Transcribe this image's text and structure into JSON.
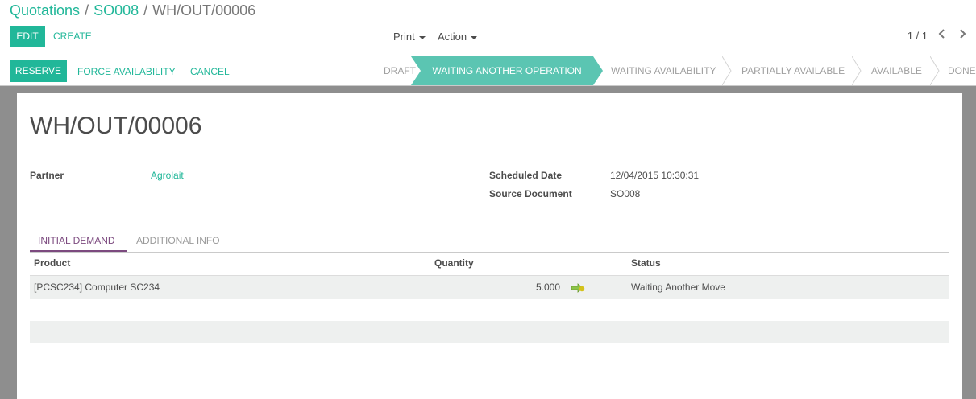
{
  "breadcrumb": {
    "items": [
      "Quotations",
      "SO008"
    ],
    "current": "WH/OUT/00006",
    "separator": "/"
  },
  "toolbar": {
    "edit_label": "EDIT",
    "create_label": "CREATE",
    "print_label": "Print",
    "action_label": "Action",
    "pager_text": "1 / 1"
  },
  "statusbar": {
    "buttons": {
      "reserve": "RESERVE",
      "force_availability": "FORCE AVAILABILITY",
      "cancel": "CANCEL"
    },
    "stages": {
      "draft": "DRAFT",
      "waiting_another_operation": "WAITING ANOTHER OPERATION",
      "waiting_availability": "WAITING AVAILABILITY",
      "partially_available": "PARTIALLY AVAILABLE",
      "available": "AVAILABLE",
      "done": "DONE"
    },
    "active_stage": "WAITING ANOTHER OPERATION"
  },
  "form": {
    "title": "WH/OUT/00006",
    "partner_label": "Partner",
    "partner_value": "Agrolait",
    "scheduled_date_label": "Scheduled Date",
    "scheduled_date_value": "12/04/2015 10:30:31",
    "source_document_label": "Source Document",
    "source_document_value": "SO008"
  },
  "tabs": {
    "initial_demand": "INITIAL DEMAND",
    "additional_info": "ADDITIONAL INFO",
    "active": "INITIAL DEMAND"
  },
  "table": {
    "columns": {
      "product": "Product",
      "quantity": "Quantity",
      "status": "Status"
    },
    "rows": [
      {
        "product": "[PCSC234] Computer SC234",
        "quantity": "5.000",
        "status": "Waiting Another Move"
      }
    ]
  },
  "colors": {
    "brand": "#21b799",
    "active_stage_bg": "#5bc5b2",
    "tab_active": "#7c4a7f",
    "sheet_backdrop": "#8e8e8e",
    "row_bg": "#eef0ef"
  },
  "icons": {
    "pager_prev": "chevron-left-icon",
    "pager_next": "chevron-right-icon",
    "move_forecast": "arrow-right-icon"
  }
}
